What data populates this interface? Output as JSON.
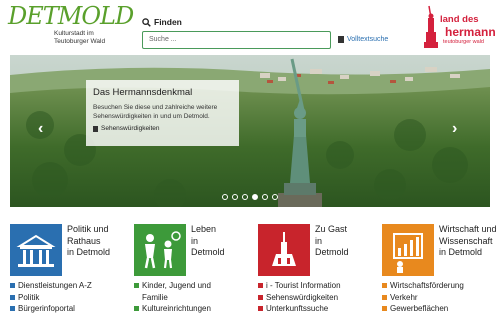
{
  "header": {
    "logo_word": "DETMOLD",
    "logo_tagline": "Kulturstadt im Teutoburger Wald",
    "search_title": "Finden",
    "search_placeholder": "Suche ...",
    "fulltext_link": "Volltextsuche",
    "partner_logo": {
      "line1": "land des",
      "line2": "hermann",
      "line3": "teutoburger wald"
    }
  },
  "hero": {
    "title": "Das Hermannsdenkmal",
    "description": "Besuchen Sie diese und zahlreiche weitere Sehenswürdigkeiten in und um Detmold.",
    "link": "Sehenswürdigkeiten",
    "slide_count": 6,
    "active_slide": 4,
    "prev_icon": "chevron-left-icon",
    "next_icon": "chevron-right-icon"
  },
  "categories": [
    {
      "title_lines": [
        "Politik und",
        "Rathaus",
        "in Detmold"
      ],
      "color": "#2a6fb0",
      "icon": "town-hall-icon",
      "links": [
        "Dienstleistungen A-Z",
        "Politik",
        "Bürgerinfoportal"
      ]
    },
    {
      "title_lines": [
        "Leben",
        "in",
        "Detmold"
      ],
      "color": "#3d9a3a",
      "icon": "family-icon",
      "links": [
        "Kinder, Jugend und",
        "Familie",
        "Kultureinrichtungen"
      ]
    },
    {
      "title_lines": [
        "Zu Gast",
        "in",
        "Detmold"
      ],
      "color": "#c8242c",
      "icon": "monument-icon",
      "links": [
        "i - Tourist Information",
        "Sehenswürdigkeiten",
        "Unterkunftssuche"
      ]
    },
    {
      "title_lines": [
        "Wirtschaft und",
        "Wissenschaft",
        "in Detmold"
      ],
      "color": "#e8891e",
      "icon": "business-chart-icon",
      "links": [
        "Wirtschaftsförderung",
        "Verkehr",
        "Gewerbeflächen"
      ]
    }
  ]
}
